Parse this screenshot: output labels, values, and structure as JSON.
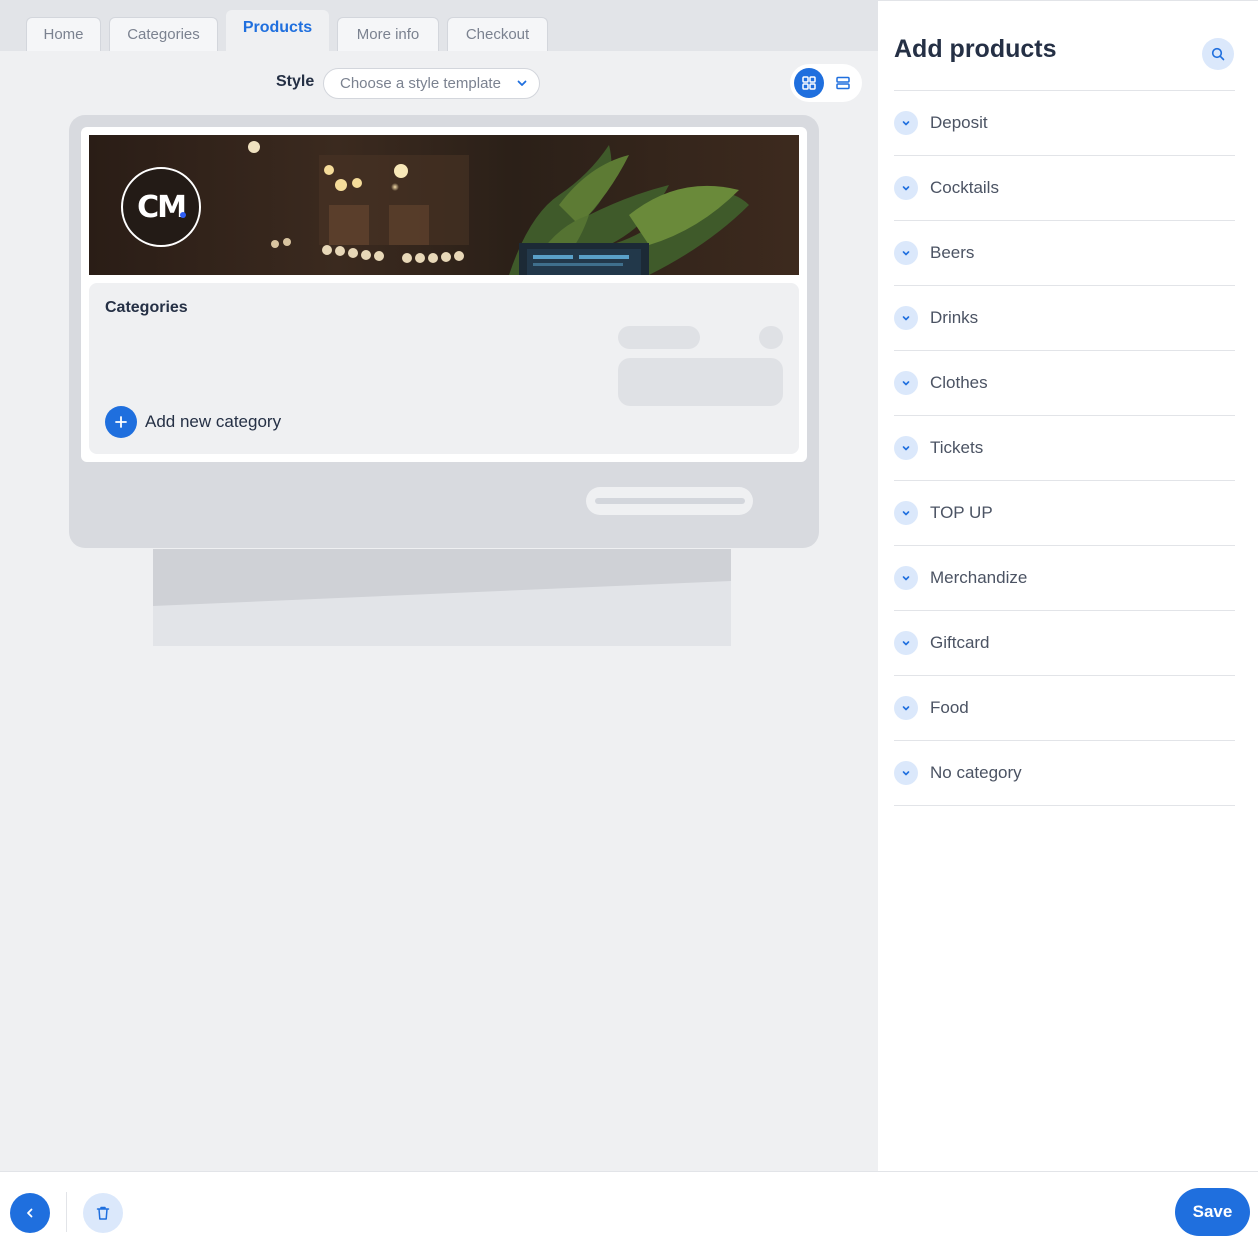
{
  "tabs": [
    {
      "label": "Home"
    },
    {
      "label": "Categories"
    },
    {
      "label": "Products"
    },
    {
      "label": "More info"
    },
    {
      "label": "Checkout"
    }
  ],
  "active_tab": "Products",
  "style_bar": {
    "label": "Style",
    "select_placeholder": "Choose a style template"
  },
  "view_toggle": {
    "selected": "grid-view",
    "options": [
      "grid-view-icon",
      "list-view-icon"
    ]
  },
  "preview": {
    "logo_text": "CM",
    "categories_title": "Categories",
    "add_category_label": "Add new category"
  },
  "panel": {
    "title": "Add products",
    "categories": [
      {
        "label": "Deposit"
      },
      {
        "label": "Cocktails"
      },
      {
        "label": "Beers"
      },
      {
        "label": "Drinks"
      },
      {
        "label": "Clothes"
      },
      {
        "label": "Tickets"
      },
      {
        "label": "TOP UP"
      },
      {
        "label": "Merchandize"
      },
      {
        "label": "Giftcard"
      },
      {
        "label": "Food"
      },
      {
        "label": "No category"
      }
    ]
  },
  "footer": {
    "save_label": "Save"
  },
  "colors": {
    "accent": "#1f6fde",
    "accent_light": "#dbe8fb",
    "workspace_bg": "#eff0f2",
    "text": "#253045"
  }
}
